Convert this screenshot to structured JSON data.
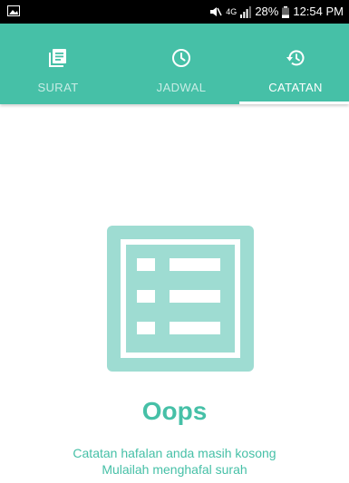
{
  "status_bar": {
    "network": "4G",
    "battery": "28%",
    "time": "12:54 PM"
  },
  "tabs": [
    {
      "label": "SURAT",
      "icon": "book-icon"
    },
    {
      "label": "JADWAL",
      "icon": "clock-icon"
    },
    {
      "label": "CATATAN",
      "icon": "history-icon"
    }
  ],
  "active_tab": "CATATAN",
  "empty_state": {
    "title": "Oops",
    "message_line1": "Catatan hafalan anda masih kosong",
    "message_line2": "Mulailah menghafal surah",
    "icon": "list-icon"
  },
  "colors": {
    "accent": "#46c0a7",
    "illustration": "#9edcd2",
    "status_bar": "#000000"
  }
}
